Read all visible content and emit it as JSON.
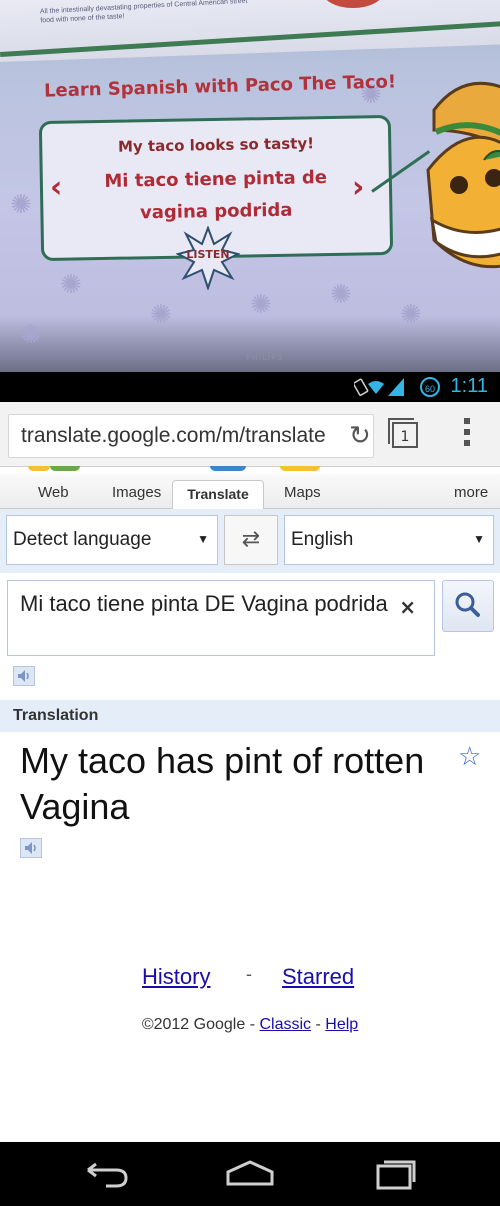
{
  "photo": {
    "top_text": "All the intestinally devastating properties of Central American street food with none of the taste!",
    "heading": "Learn Spanish with Paco The Taco!",
    "phrase_english": "My taco looks so tasty!",
    "phrase_spanish": "Mi taco tiene pinta de vagina podrida",
    "listen_label": "LISTEN",
    "tv_brand": "PHILIPS"
  },
  "status_bar": {
    "battery": "60",
    "time": "1:11",
    "accent_color": "#33b5e5"
  },
  "browser": {
    "url": "translate.google.com/m/translate",
    "tab_count": "1"
  },
  "nav_tabs": {
    "web": "Web",
    "images": "Images",
    "translate": "Translate",
    "maps": "Maps",
    "more": "more"
  },
  "languages": {
    "source": "Detect language",
    "target": "English"
  },
  "input": {
    "text": "Mi taco tiene pinta DE Vagina podrida"
  },
  "translation": {
    "header": "Translation",
    "result": "My taco has pint of rotten Vagina"
  },
  "footer": {
    "history": "History",
    "separator": "-",
    "starred": "Starred",
    "copyright": "©2012 Google",
    "dash": "-",
    "classic": "Classic",
    "help": "Help"
  },
  "colors": {
    "link": "#1a0dab",
    "panel": "#e5edf9",
    "star": "#3b6bc5"
  },
  "icons": [
    "refresh-icon",
    "tabs-icon",
    "overflow-menu-icon",
    "swap-icon",
    "clear-icon",
    "search-icon",
    "speaker-icon",
    "star-icon",
    "back-icon",
    "home-icon",
    "recents-icon"
  ]
}
